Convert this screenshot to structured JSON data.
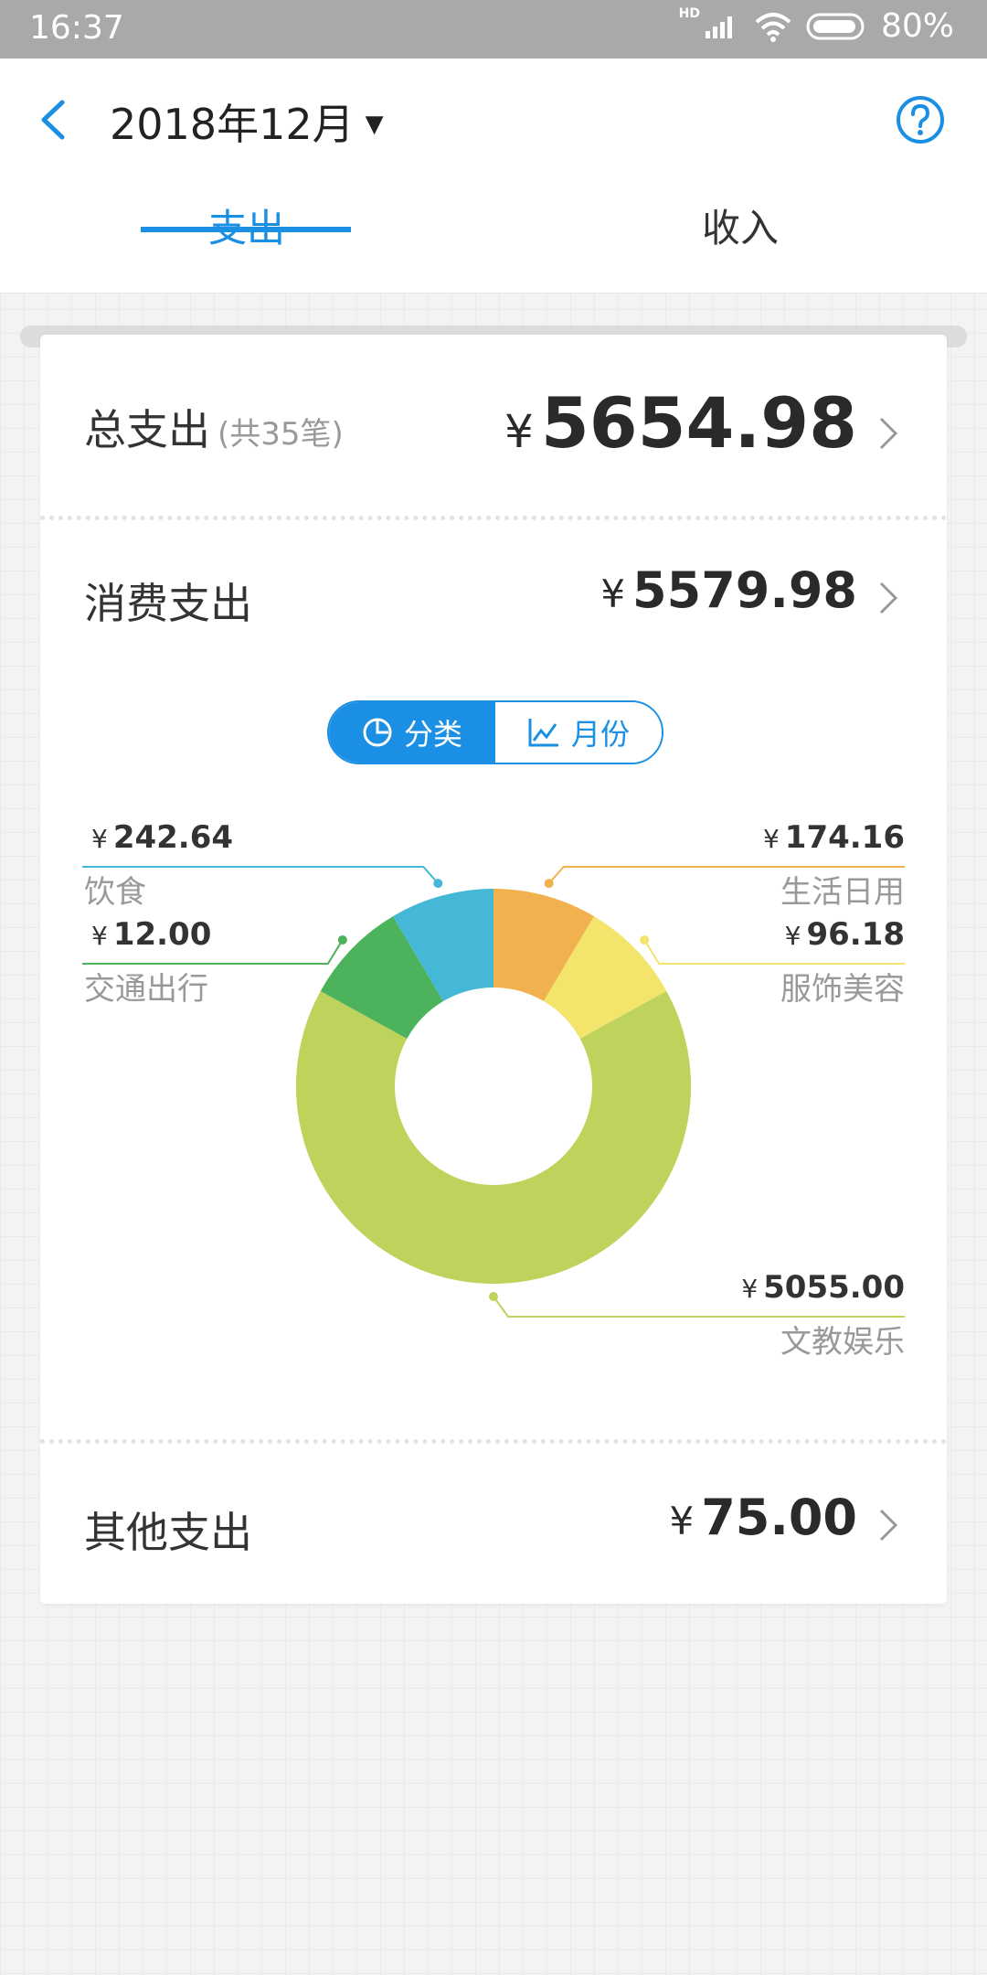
{
  "status": {
    "time": "16:37",
    "hd": "HD",
    "battery": "80%"
  },
  "header": {
    "month": "2018年12月",
    "tabs": {
      "expense": "支出",
      "income": "收入"
    }
  },
  "total": {
    "label": "总支出",
    "count": "(共35笔)",
    "currency": "¥",
    "amount": "5654.98"
  },
  "consumption": {
    "label": "消费支出",
    "currency": "¥",
    "amount": "5579.98"
  },
  "toggle": {
    "category": "分类",
    "month": "月份"
  },
  "colors": {
    "accent": "#1a8fe3",
    "food": "#45b8d7",
    "transport": "#4cb35c",
    "entertainment": "#bed35b",
    "apparel": "#f3e56c",
    "daily": "#f0b14e"
  },
  "chart_data": {
    "type": "pie",
    "categories": [
      "生活日用",
      "服饰美容",
      "文教娱乐",
      "交通出行",
      "饮食"
    ],
    "values": [
      174.16,
      96.18,
      5055.0,
      12.0,
      242.64
    ],
    "labels": {
      "daily": {
        "name": "生活日用",
        "amount": "174.16"
      },
      "apparel": {
        "name": "服饰美容",
        "amount": "96.18"
      },
      "entertainment": {
        "name": "文教娱乐",
        "amount": "5055.00"
      },
      "transport": {
        "name": "交通出行",
        "amount": "12.00"
      },
      "food": {
        "name": "饮食",
        "amount": "242.64"
      }
    },
    "currency": "¥"
  },
  "other": {
    "label": "其他支出",
    "currency": "¥",
    "amount": "75.00"
  }
}
